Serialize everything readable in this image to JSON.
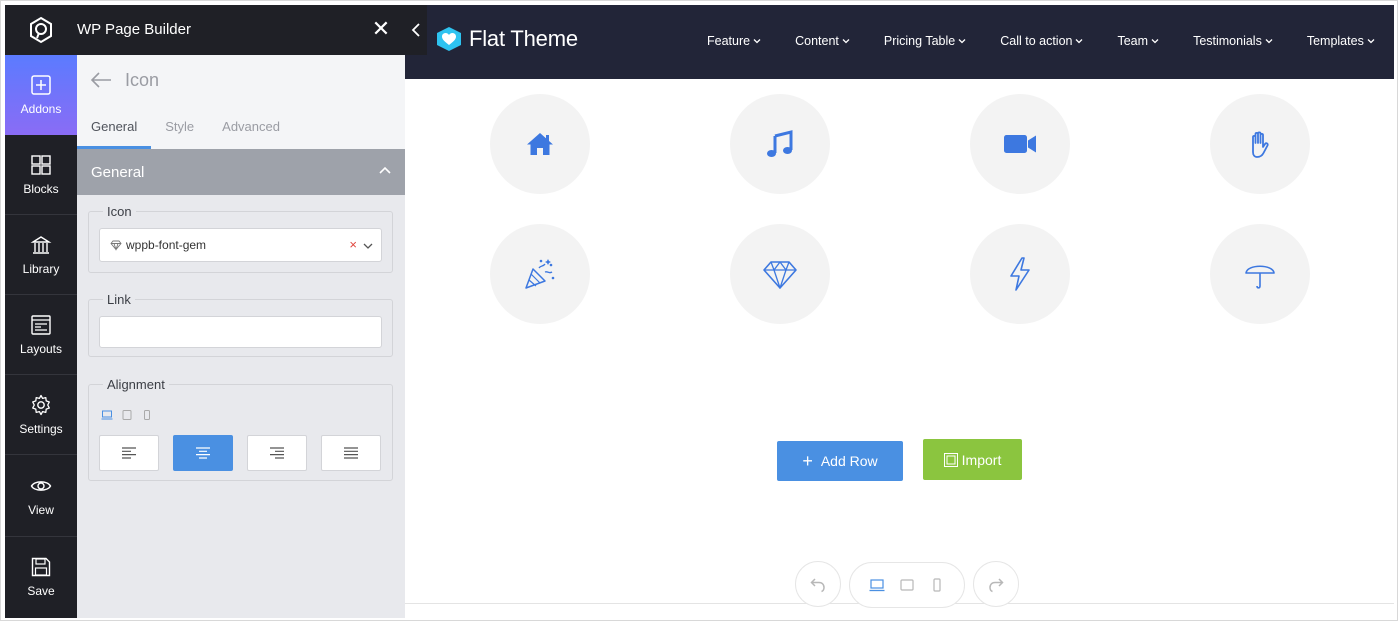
{
  "builder": {
    "title": "WP Page Builder",
    "close_glyph": "✕"
  },
  "rail": {
    "items": [
      {
        "label": "Addons",
        "icon": "plus-square-icon"
      },
      {
        "label": "Blocks",
        "icon": "blocks-icon"
      },
      {
        "label": "Library",
        "icon": "library-icon"
      },
      {
        "label": "Layouts",
        "icon": "layouts-icon"
      },
      {
        "label": "Settings",
        "icon": "gear-icon"
      },
      {
        "label": "View",
        "icon": "eye-icon"
      },
      {
        "label": "Save",
        "icon": "floppy-icon"
      }
    ]
  },
  "panel": {
    "addon_title": "Icon",
    "tabs": [
      "General",
      "Style",
      "Advanced"
    ],
    "active_tab": "General",
    "section_title": "General",
    "icon_field": {
      "label": "Icon",
      "value": "wppb-font-gem",
      "clear_glyph": "×"
    },
    "link_field": {
      "label": "Link",
      "value": ""
    },
    "alignment_field": {
      "label": "Alignment",
      "options": [
        "left",
        "center",
        "right",
        "justify"
      ],
      "selected": "center"
    }
  },
  "site": {
    "brand": "Flat Theme",
    "nav": [
      "Feature",
      "Content",
      "Pricing Table",
      "Call to action",
      "Team",
      "Testimonials",
      "Templates"
    ],
    "icons": [
      "home-icon",
      "music-icon",
      "video-camera-icon",
      "hand-icon",
      "party-popper-icon",
      "gem-icon",
      "lightning-icon",
      "umbrella-icon"
    ]
  },
  "actions": {
    "add_row": "Add Row",
    "import": "Import"
  },
  "colors": {
    "accent": "#4a90e2",
    "import_green": "#8bc53f",
    "dark": "#1f2026",
    "header_bg": "#222538"
  }
}
